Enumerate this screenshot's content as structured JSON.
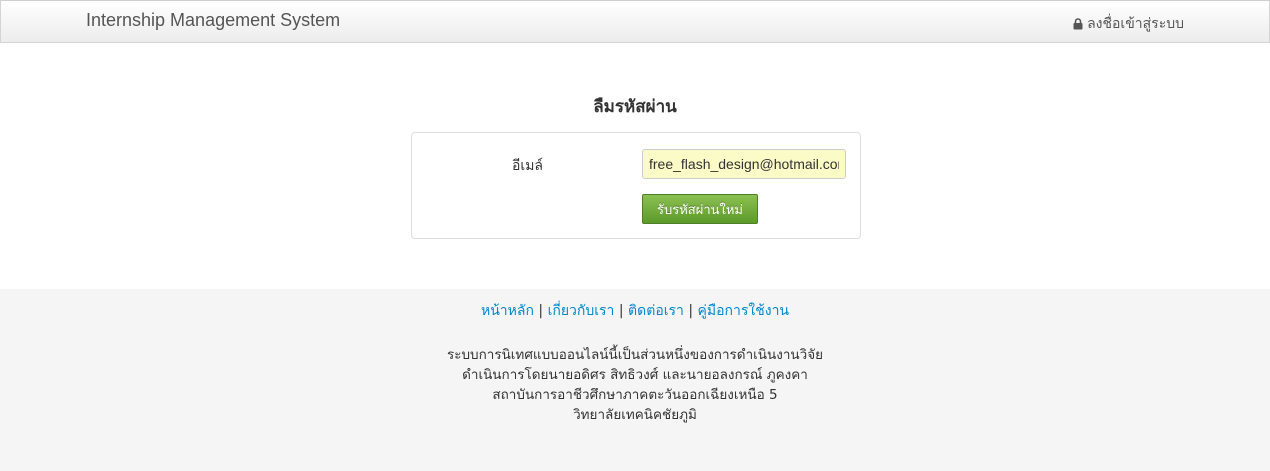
{
  "navbar": {
    "brand": "Internship Management System",
    "login_label": "ลงชื่อเข้าสู่ระบบ",
    "login_icon": "lock-icon"
  },
  "main": {
    "title": "ลืมรหัสผ่าน",
    "email_label": "อีเมล์",
    "email_value": "free_flash_design@hotmail.com",
    "submit_label": "รับรหัสผ่านใหม่"
  },
  "footer": {
    "links": [
      "หน้าหลัก",
      "เกี่ยวกับเรา",
      "ติดต่อเรา",
      "คู่มือการใช้งาน"
    ],
    "separator": "|",
    "lines": [
      "ระบบการนิเทศแบบออนไลน์นี้เป็นส่วนหนึ่งของการดำเนินงานวิจัย",
      "ดำเนินการโดยนายอดิศร สิทธิวงศ์ และนายอลงกรณ์ ภูคงคา",
      "สถาบันการอาชีวศึกษาภาคตะวันออกเฉียงเหนือ 5",
      "วิทยาลัยเทคนิคชัยภูมิ"
    ]
  },
  "colors": {
    "link": "#0088cc",
    "button": "#6aa534",
    "input_background": "#fbfbc8",
    "footer_background": "#f5f5f5"
  }
}
